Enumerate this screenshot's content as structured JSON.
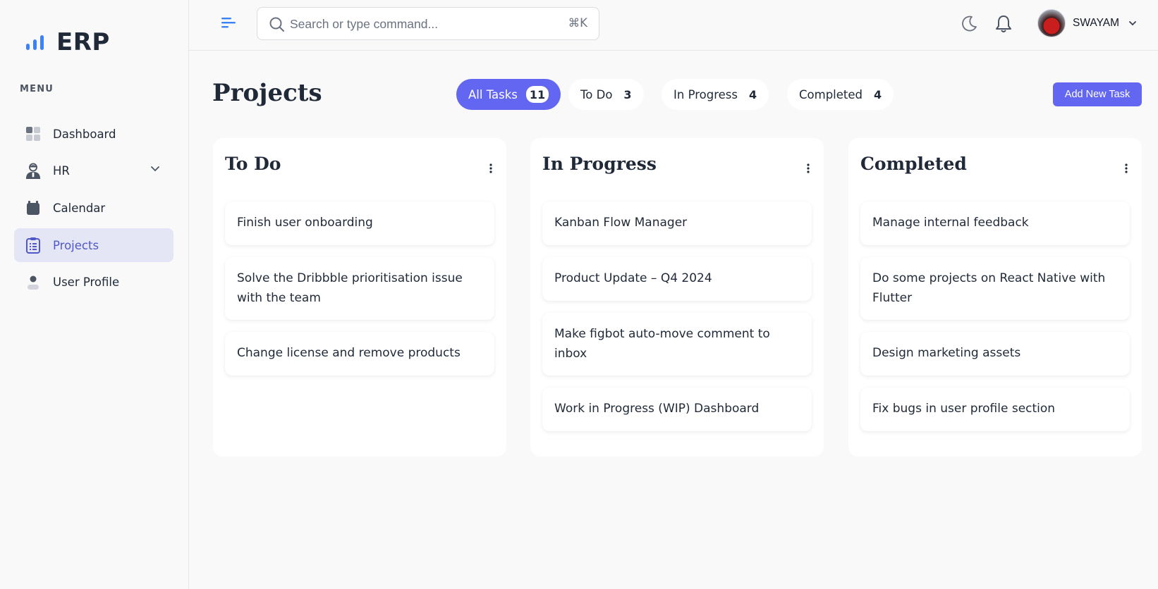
{
  "brand": {
    "name": "ERP"
  },
  "sidebar": {
    "menu_label": "MENU",
    "items": [
      {
        "label": "Dashboard",
        "icon": "dashboard-icon"
      },
      {
        "label": "HR",
        "icon": "hr-person-icon"
      },
      {
        "label": "Calendar",
        "icon": "calendar-icon"
      },
      {
        "label": "Projects",
        "icon": "clipboard-list-icon",
        "active": true
      },
      {
        "label": "User Profile",
        "icon": "user-icon"
      }
    ]
  },
  "header": {
    "search": {
      "placeholder": "Search or type command...",
      "shortcut": "⌘K"
    },
    "user": {
      "name": "SWAYAM"
    }
  },
  "main": {
    "title": "Projects",
    "filters": [
      {
        "label": "All Tasks",
        "count": "11",
        "active": true
      },
      {
        "label": "To Do",
        "count": "3"
      },
      {
        "label": "In Progress",
        "count": "4"
      },
      {
        "label": "Completed",
        "count": "4"
      }
    ],
    "add_button": "Add New Task",
    "columns": [
      {
        "title": "To Do",
        "cards": [
          "Finish user onboarding",
          "Solve the Dribbble prioritisation issue with the team",
          "Change license and remove products"
        ]
      },
      {
        "title": "In Progress",
        "cards": [
          "Kanban Flow Manager",
          "Product Update – Q4 2024",
          "Make figbot auto-move comment to inbox",
          "Work in Progress (WIP) Dashboard"
        ]
      },
      {
        "title": "Completed",
        "cards": [
          "Manage internal feedback",
          "Do some projects on React Native with Flutter",
          "Design marketing assets",
          "Fix bugs in user profile section"
        ]
      }
    ]
  },
  "colors": {
    "accent": "#6366f1",
    "active_nav_bg": "#e4e6f5",
    "active_nav_text": "#4f57c9",
    "logo_bars": "#3b82f6"
  }
}
